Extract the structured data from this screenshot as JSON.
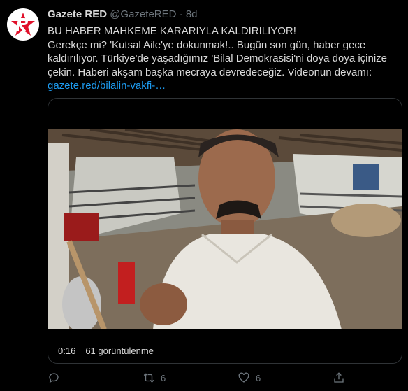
{
  "tweet": {
    "display_name": "Gazete RED",
    "handle": "@GazeteRED",
    "separator": "·",
    "time": "8d",
    "lines": [
      "BU HABER MAHKEME KARARIYLA KALDIRILIYOR!",
      "Gerekçe mi? 'Kutsal Aile'ye dokunmak!.. Bugün son gün, haber gece",
      "kaldırılıyor. Türkiye'de yaşadığımız 'Bilal Demokrasisi'ni doya doya içinize",
      "çekin. Haberi akşam başka mecraya devredeceğiz. Videonun devamı:"
    ],
    "link": "gazete.red/bilalin-vakfi-…"
  },
  "video": {
    "duration": "0:16",
    "views": "61 görüntülenme"
  },
  "actions": {
    "reply_count": "",
    "retweet_count": "6",
    "like_count": "6"
  },
  "colors": {
    "accent": "#1d9bf0",
    "brand": "#e0102a",
    "muted": "#6e767d",
    "text": "#d9d9d9",
    "background": "#000000"
  }
}
